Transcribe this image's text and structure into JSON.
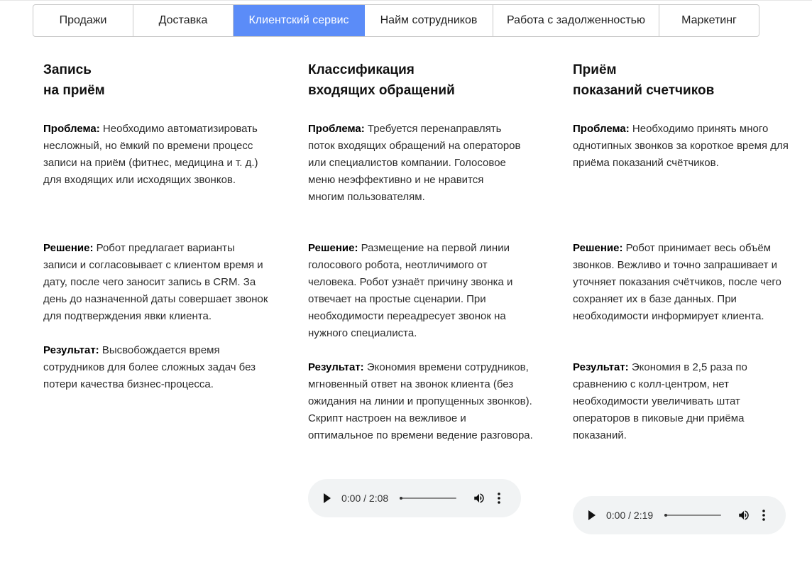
{
  "tabs": [
    {
      "label": "Продажи",
      "active": false
    },
    {
      "label": "Доставка",
      "active": false
    },
    {
      "label": "Клиентский сервис",
      "active": true
    },
    {
      "label": "Найм сотрудников",
      "active": false
    },
    {
      "label": "Работа с задолженностью",
      "active": false
    },
    {
      "label": "Маркетинг",
      "active": false
    }
  ],
  "columns": [
    {
      "title_line1": "Запись",
      "title_line2": "на приём",
      "problem_label": "Проблема:",
      "problem_text": "Необходимо автоматизировать несложный, но ёмкий по времени процесс записи на приём (фитнес, медицина и т. д.) для входящих или исходящих звонков.",
      "solution_label": "Решение:",
      "solution_text": "Робот предлагает варианты записи и согласовывает с клиентом время и дату, после чего заносит запись в CRM. За день до назначенной даты совершает звонок для подтверждения явки клиента.",
      "result_label": "Результат:",
      "result_text": "Высвобождается время сотрудников для более сложных задач без потери качества бизнес-процесса."
    },
    {
      "title_line1": "Классификация",
      "title_line2": "входящих обращений",
      "problem_label": "Проблема:",
      "problem_text": "Требуется перенаправлять поток входящих обращений на операторов или специалистов компании. Голосовое меню неэффективно и не нравится многим пользователям.",
      "solution_label": "Решение:",
      "solution_text": "Размещение на первой линии голосового робота, неотличимого от человека. Робот узнаёт причину звонка и отвечает на простые сценарии. При необходимости переадресует звонок на нужного специалиста.",
      "result_label": "Результат:",
      "result_text": "Экономия времени сотрудников, мгновенный ответ на звонок клиента (без ожидания на линии и пропущенных звонков). Скрипт настроен на вежливое и оптимальное по времени ведение разговора.",
      "audio_time": "0:00 / 2:08",
      "audio_progress": 0
    },
    {
      "title_line1": "Приём",
      "title_line2": "показаний счетчиков",
      "problem_label": "Проблема:",
      "problem_text": "Необходимо принять много однотипных звонков за короткое время для приёма показаний счётчиков.",
      "solution_label": "Решение:",
      "solution_text": "Робот принимает весь объём звонков. Вежливо и точно запрашивает и уточняет показания счётчиков, после чего сохраняет их в базе данных. При необходимости информирует клиента.",
      "result_label": "Результат:",
      "result_text": "Экономия в 2,5 раза по сравнению с колл-центром, нет необходимости увеличивать штат операторов в пиковые дни приёма показаний.",
      "audio_time": "0:00 / 2:19",
      "audio_progress": 0
    }
  ],
  "icons": {
    "play": "play-icon",
    "volume": "volume-icon",
    "more": "more-vertical-icon"
  },
  "colors": {
    "active_tab": "#5b8cf8",
    "player_bg": "#f1f3f4"
  }
}
